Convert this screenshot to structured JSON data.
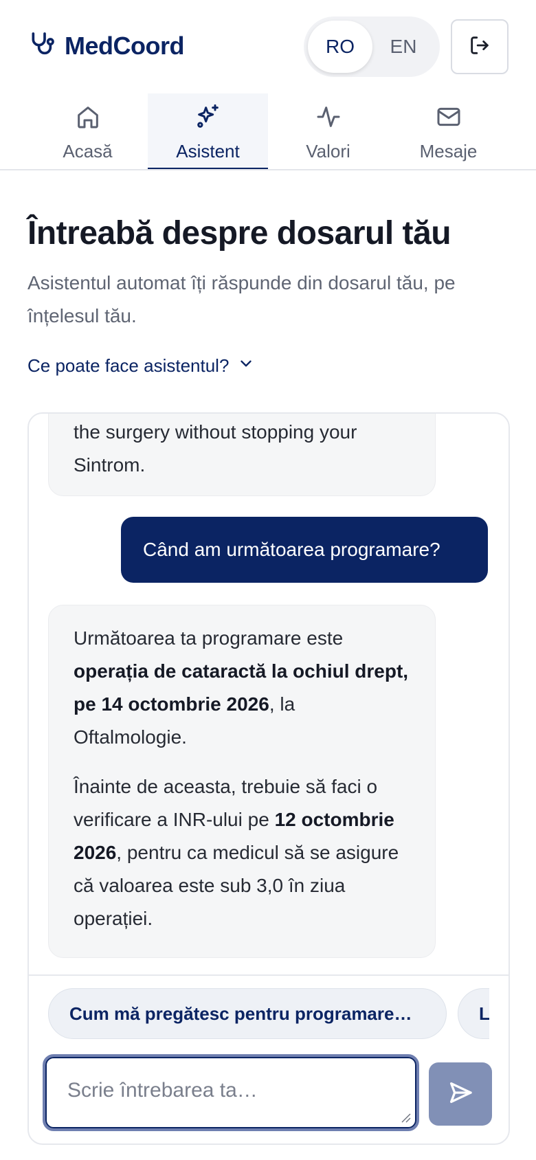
{
  "app": {
    "name": "MedCoord"
  },
  "language": {
    "options": [
      "RO",
      "EN"
    ],
    "selected": "RO"
  },
  "nav": {
    "tabs": [
      {
        "label": "Acasă",
        "icon": "home-icon"
      },
      {
        "label": "Asistent",
        "icon": "sparkles-icon",
        "active": true
      },
      {
        "label": "Valori",
        "icon": "activity-icon"
      },
      {
        "label": "Mesaje",
        "icon": "mail-icon"
      }
    ]
  },
  "page": {
    "title": "Întreabă despre dosarul tău",
    "subtitle": "Asistentul automat îți răspunde din dosarul tău, pe înțelesul tău.",
    "capabilities_link": "Ce poate face asistentul?"
  },
  "chat": {
    "messages": [
      {
        "role": "assistant",
        "lines": [
          "the surgery without stopping your",
          "Sintrom."
        ]
      },
      {
        "role": "user",
        "text": "Când am următoarea programare?"
      },
      {
        "role": "assistant",
        "p1_a": "Următoarea ta programare este ",
        "p1_bold": "operația de cataractă la ochiul drept, pe 14 octombrie 2026",
        "p1_b": ", la Oftalmologie.",
        "p2_a": "Înainte de aceasta, trebuie să faci o verificare a INR-ului pe ",
        "p2_bold": "12 octombrie 2026",
        "p2_b": ", pentru ca medicul să se asigure că valoarea este sub 3,0 în ziua operației."
      }
    ],
    "suggestions": [
      "Cum mă pregătesc pentru programare…",
      "La"
    ],
    "input_placeholder": "Scrie întrebarea ta…",
    "input_value": ""
  },
  "colors": {
    "brand": "#0b2463",
    "send_button": "#8190b6",
    "bot_bubble": "#f5f6f7"
  }
}
